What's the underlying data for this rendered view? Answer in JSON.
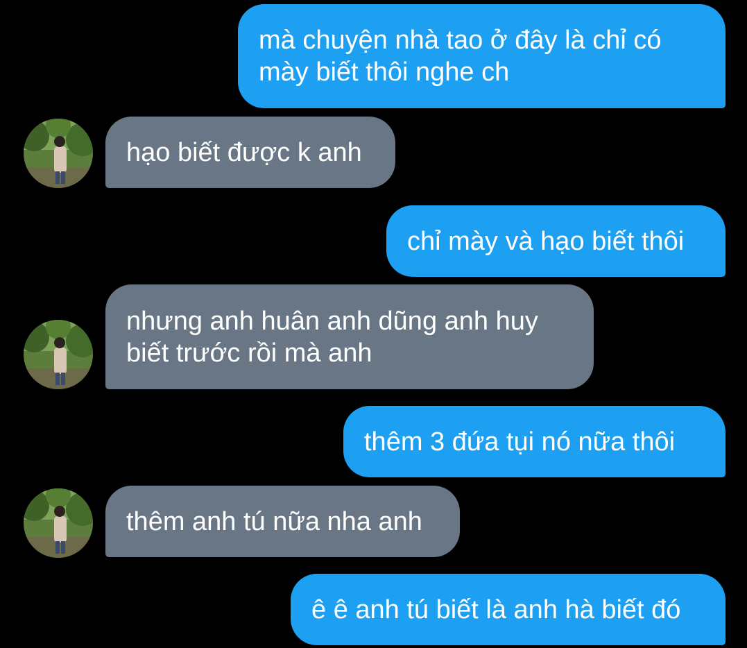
{
  "conversation": {
    "messages": [
      {
        "direction": "outgoing",
        "text": "mà chuyện nhà tao ở đây là chỉ có\nmày biết thôi nghe ch"
      },
      {
        "direction": "incoming",
        "text": "hạo biết được k anh"
      },
      {
        "direction": "outgoing",
        "text": "chỉ mày và hạo biết thôi"
      },
      {
        "direction": "incoming",
        "text": "nhưng anh huân anh dũng anh huy\nbiết trước rồi mà anh"
      },
      {
        "direction": "outgoing",
        "text": "thêm 3 đứa tụi nó nữa thôi"
      },
      {
        "direction": "incoming",
        "text": "thêm anh tú nữa nha anh"
      },
      {
        "direction": "outgoing",
        "text": "ê ê anh tú biết là anh hà biết đó"
      }
    ]
  },
  "colors": {
    "background": "#000000",
    "outgoing_bubble": "#1ea0f2",
    "incoming_bubble": "#687685",
    "text": "#ffffff"
  },
  "icons": {
    "avatar": "contact-avatar-icon"
  }
}
